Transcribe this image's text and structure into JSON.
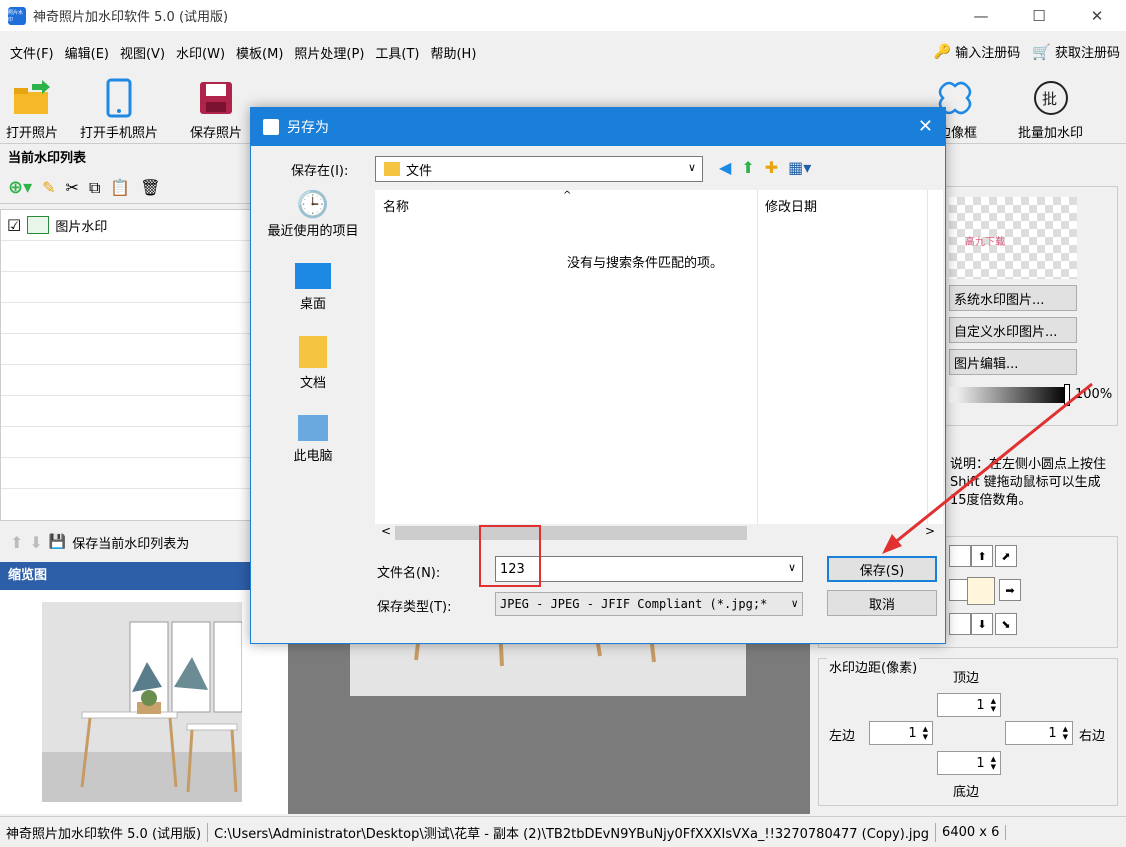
{
  "window": {
    "title": "神奇照片加水印软件 5.0 (试用版)",
    "logo_text": "照片水印",
    "min": "—",
    "max": "☐",
    "close": "✕"
  },
  "menu": [
    "文件(F)",
    "编辑(E)",
    "视图(V)",
    "水印(W)",
    "模板(M)",
    "照片处理(P)",
    "工具(T)",
    "帮助(H)"
  ],
  "menu_right": {
    "register": "输入注册码",
    "get_code": "获取注册码"
  },
  "toolbar": {
    "open": "打开照片",
    "open_phone": "打开手机照片",
    "save": "保存照片",
    "border": "花边像框",
    "batch": "批量加水印"
  },
  "left": {
    "list_title": "当前水印列表",
    "item": "图片水印",
    "save_list": "保存当前水印列表为",
    "thumbnail_title": "缩览图"
  },
  "right": {
    "preview_text": "高九下载",
    "sys_btn": "系统水印图片...",
    "custom_btn": "自定义水印图片...",
    "edit_btn": "图片编辑...",
    "opacity": "100%",
    "hint": "说明：在左侧小圆点上按住 Shift 键拖动鼠标可以生成15度倍数角。",
    "margin_title": "水印边距(像素)",
    "top_label": "顶边",
    "left_label": "左边",
    "right_label": "右边",
    "bottom_label": "底边",
    "top": "1",
    "left_val": "1",
    "right_val": "1",
    "bottom": "1"
  },
  "dialog": {
    "title": "另存为",
    "save_in_label": "保存在(I):",
    "folder": "文件",
    "places": [
      "最近使用的项目",
      "桌面",
      "文档",
      "此电脑"
    ],
    "col_name": "名称",
    "col_date": "修改日期",
    "empty": "没有与搜索条件匹配的项。",
    "filename_label": "文件名(N):",
    "filename": "123",
    "filetype_label": "保存类型(T):",
    "filetype": "JPEG - JPEG - JFIF Compliant (*.jpg;*",
    "save": "保存(S)",
    "cancel": "取消"
  },
  "status": {
    "app": "神奇照片加水印软件 5.0 (试用版)",
    "path": "C:\\Users\\Administrator\\Desktop\\测试\\花草 - 副本 (2)\\TB2tbDEvN9YBuNjy0FfXXXIsVXa_!!3270780477 (Copy).jpg",
    "size": "6400 x 6"
  },
  "colors": {
    "accent": "#1a7fd8",
    "thumb_header": "#2d5ea8",
    "annotation": "#e03030"
  }
}
